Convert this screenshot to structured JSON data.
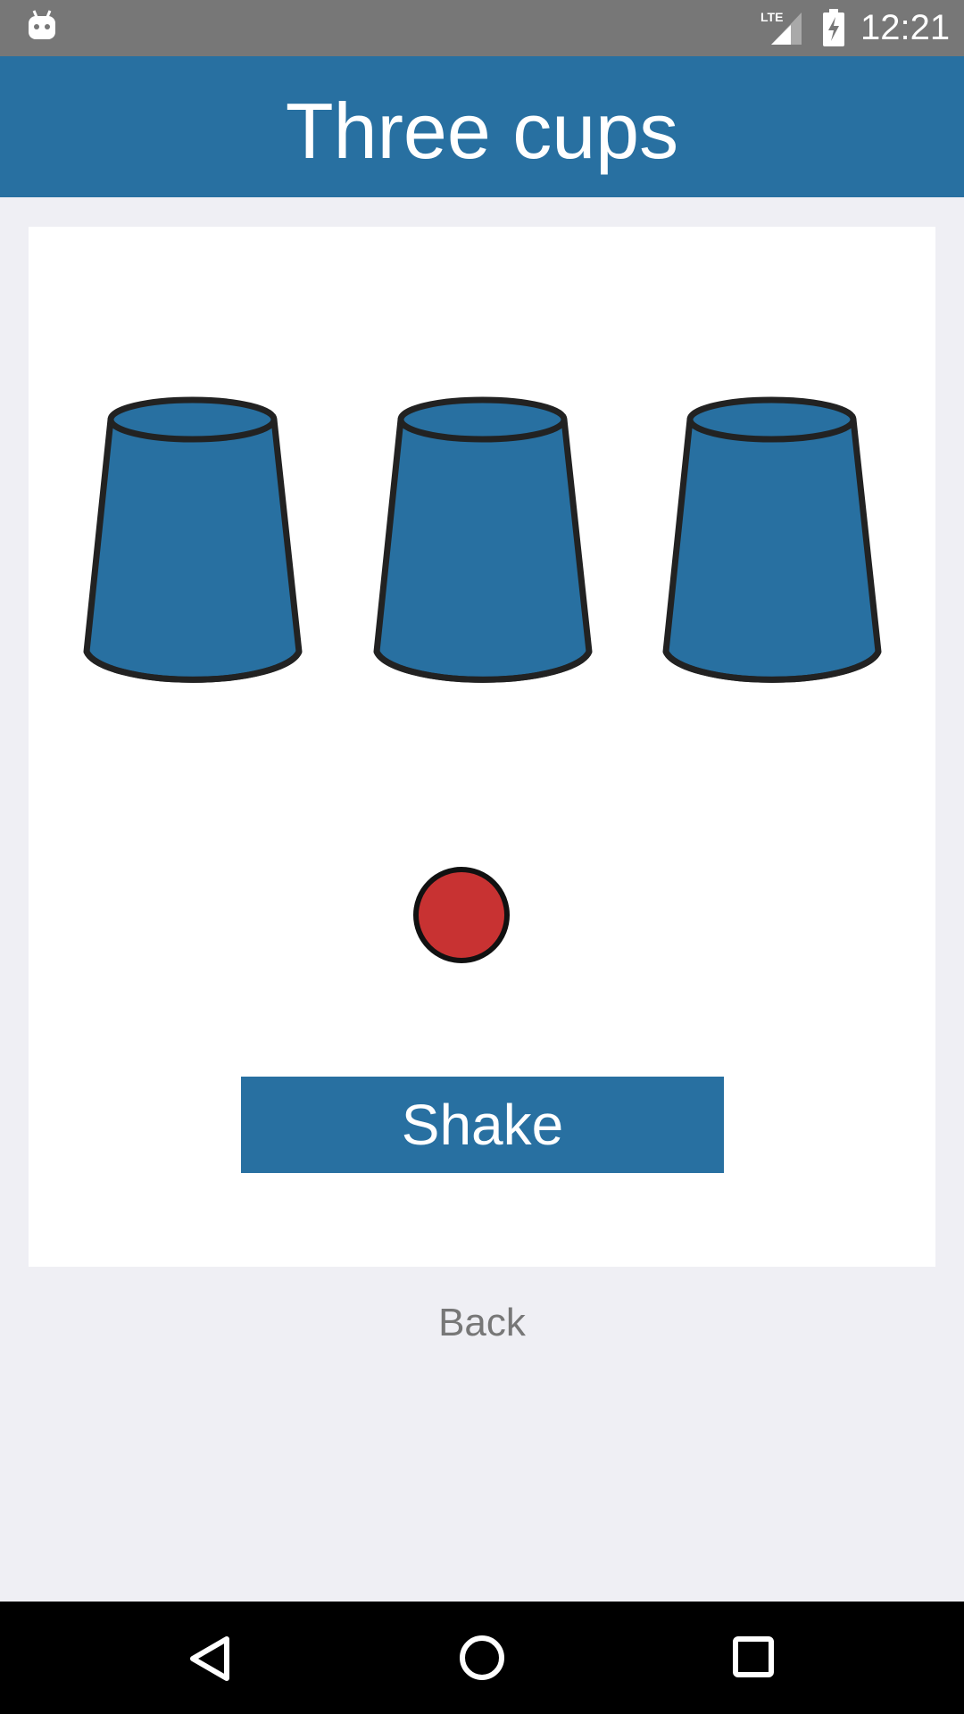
{
  "status_bar": {
    "time": "12:21",
    "network": "LTE",
    "icons": [
      "android-icon",
      "lte-signal-icon",
      "battery-charging-icon"
    ]
  },
  "app_bar": {
    "title": "Three cups"
  },
  "game": {
    "cups": [
      {
        "name": "cup-left"
      },
      {
        "name": "cup-middle"
      },
      {
        "name": "cup-right"
      }
    ],
    "ball_color": "#c83232",
    "cup_color": "#2870a1",
    "shake_label": "Shake"
  },
  "back_label": "Back",
  "nav_bar": {
    "icons": [
      "back-triangle-icon",
      "home-circle-icon",
      "recents-square-icon"
    ]
  },
  "colors": {
    "primary": "#2870a1",
    "status_bar": "#777777",
    "background": "#efeff4"
  }
}
